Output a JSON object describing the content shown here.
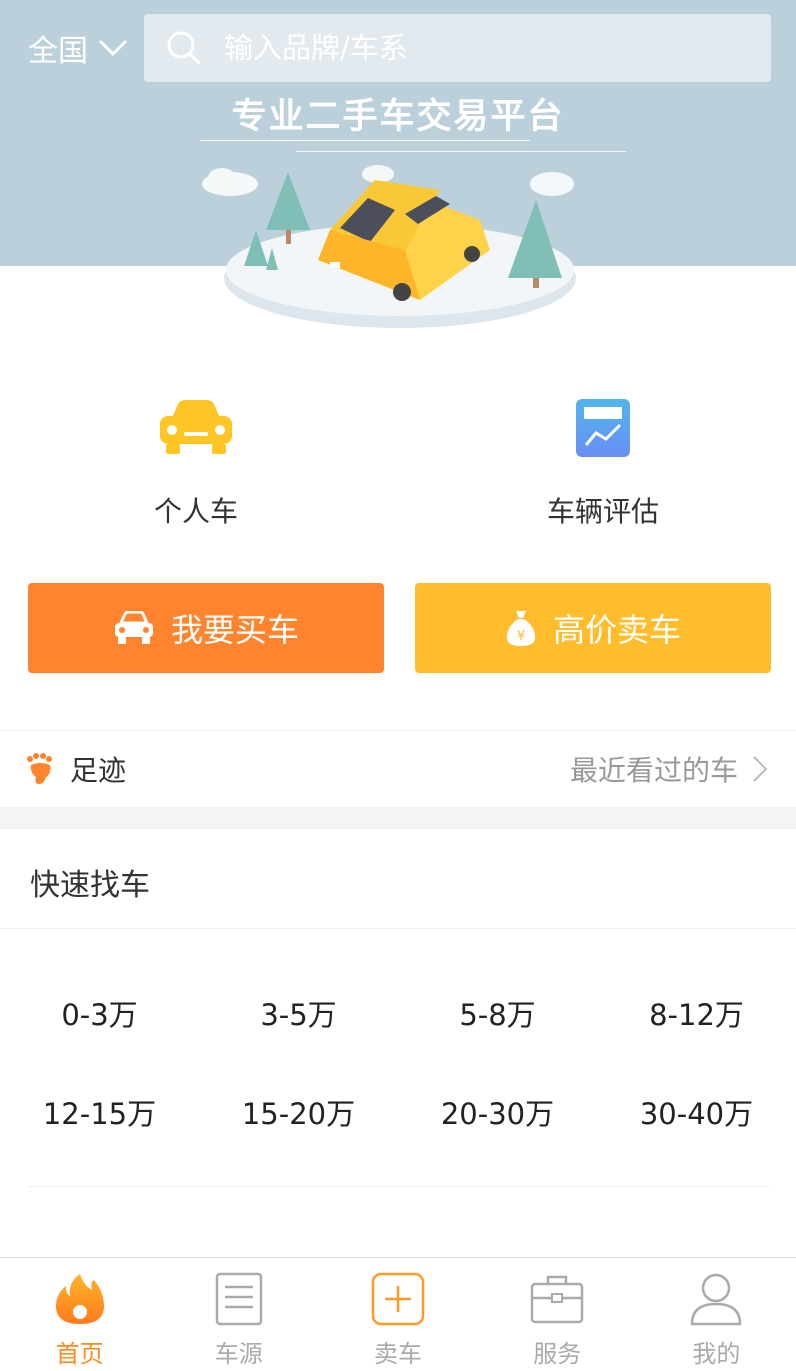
{
  "header": {
    "city": "全国",
    "search_placeholder": "输入品牌/车系",
    "slogan": "专业二手车交易平台"
  },
  "features": [
    {
      "label": "个人车",
      "icon": "car-front-icon"
    },
    {
      "label": "车辆评估",
      "icon": "evaluation-chart-icon"
    }
  ],
  "actions": {
    "buy_label": "我要买车",
    "sell_label": "高价卖车"
  },
  "footprint": {
    "label": "足迹",
    "link": "最近看过的车"
  },
  "quick_find": {
    "title": "快速找车",
    "price_ranges": [
      "0-3万",
      "3-5万",
      "5-8万",
      "8-12万",
      "12-15万",
      "15-20万",
      "20-30万",
      "30-40万"
    ]
  },
  "bottom_nav": [
    {
      "label": "首页",
      "icon": "flame-icon",
      "active": true
    },
    {
      "label": "车源",
      "icon": "list-icon",
      "active": false
    },
    {
      "label": "卖车",
      "icon": "plus-box-icon",
      "active": false
    },
    {
      "label": "服务",
      "icon": "briefcase-icon",
      "active": false
    },
    {
      "label": "我的",
      "icon": "user-icon",
      "active": false
    }
  ],
  "colors": {
    "banner": "#bcd0dc",
    "buy": "#ff842d",
    "sell": "#ffbc2c",
    "active_nav": "#ff8b1f"
  }
}
